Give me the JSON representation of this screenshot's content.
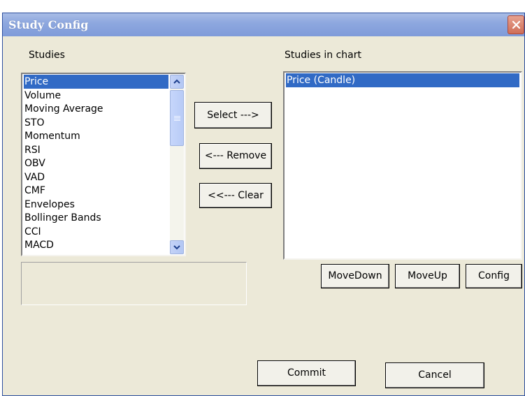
{
  "window": {
    "title": "Study Config"
  },
  "studies": {
    "label": "Studies",
    "items": [
      "Price",
      "Volume",
      "Moving Average",
      "STO",
      "Momentum",
      "RSI",
      "OBV",
      "VAD",
      "CMF",
      "Envelopes",
      "Bollinger Bands",
      "CCI",
      "MACD"
    ],
    "selected": "Price"
  },
  "chart_studies": {
    "label": "Studies in chart",
    "items": [
      "Price (Candle)"
    ],
    "selected": "Price (Candle)"
  },
  "buttons": {
    "select": "Select --->",
    "remove": "<--- Remove",
    "clear": "<<--- Clear",
    "move_down": "MoveDown",
    "move_up": "MoveUp",
    "config": "Config",
    "commit": "Commit",
    "cancel": "Cancel"
  },
  "colors": {
    "selection": "#316ac5",
    "dialog_bg": "#ece9d8",
    "titlebar": "#7f9bd9"
  }
}
